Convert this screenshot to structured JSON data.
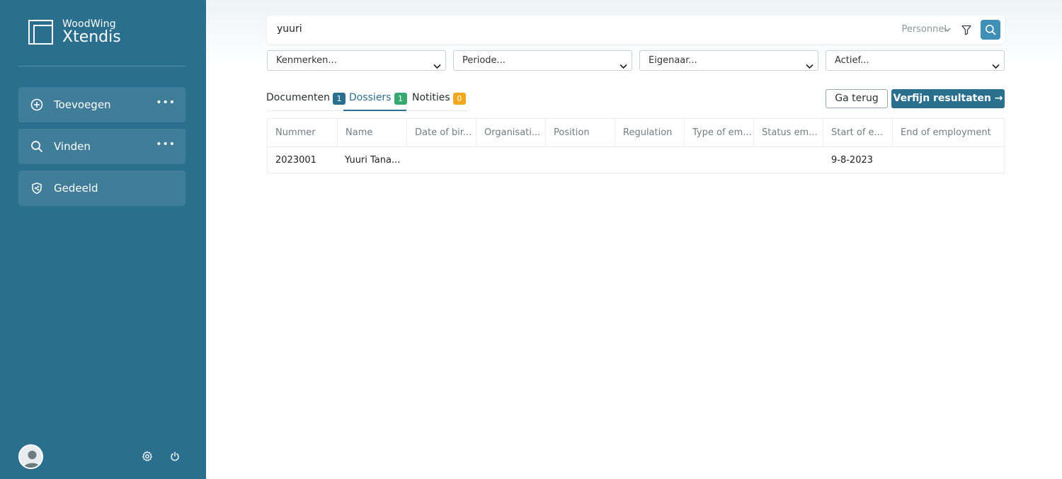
{
  "brand": {
    "line1": "WoodWing",
    "line2": "Xtendis"
  },
  "sidebar": {
    "items": [
      {
        "label": "Toevoegen",
        "icon": "plus-circle-icon",
        "more": "•••"
      },
      {
        "label": "Vinden",
        "icon": "search-icon",
        "more": "•••"
      },
      {
        "label": "Gedeeld",
        "icon": "shield-share-icon"
      }
    ],
    "footer_icons": [
      "avatar",
      "gear-icon",
      "power-icon"
    ]
  },
  "search": {
    "value": "yuuri",
    "scope": "Personnel"
  },
  "filters": [
    {
      "label": "Kenmerken..."
    },
    {
      "label": "Periode..."
    },
    {
      "label": "Eigenaar..."
    },
    {
      "label": "Actief..."
    }
  ],
  "tabs": [
    {
      "label": "Documenten",
      "count": "1",
      "badge_color": "#2b6f8e"
    },
    {
      "label": "Dossiers",
      "count": "1",
      "badge_color": "#37a86f",
      "active": true
    },
    {
      "label": "Notities",
      "count": "0",
      "badge_color": "#f2a81d"
    }
  ],
  "actions": {
    "back": "Ga terug",
    "refine": "Verfijn resultaten →"
  },
  "table": {
    "columns": [
      "Nummer",
      "Name",
      "Date of bir...",
      "Organisati...",
      "Position",
      "Regulation",
      "Type of em...",
      "Status em...",
      "Start of e...",
      "End of employment"
    ],
    "rows": [
      [
        "2023001",
        "Yuuri Tana...",
        "",
        "",
        "",
        "",
        "",
        "",
        "9-8-2023",
        ""
      ]
    ]
  },
  "colors": {
    "sidebar": "#2b6f8e",
    "accent": "#3f8fb6"
  }
}
